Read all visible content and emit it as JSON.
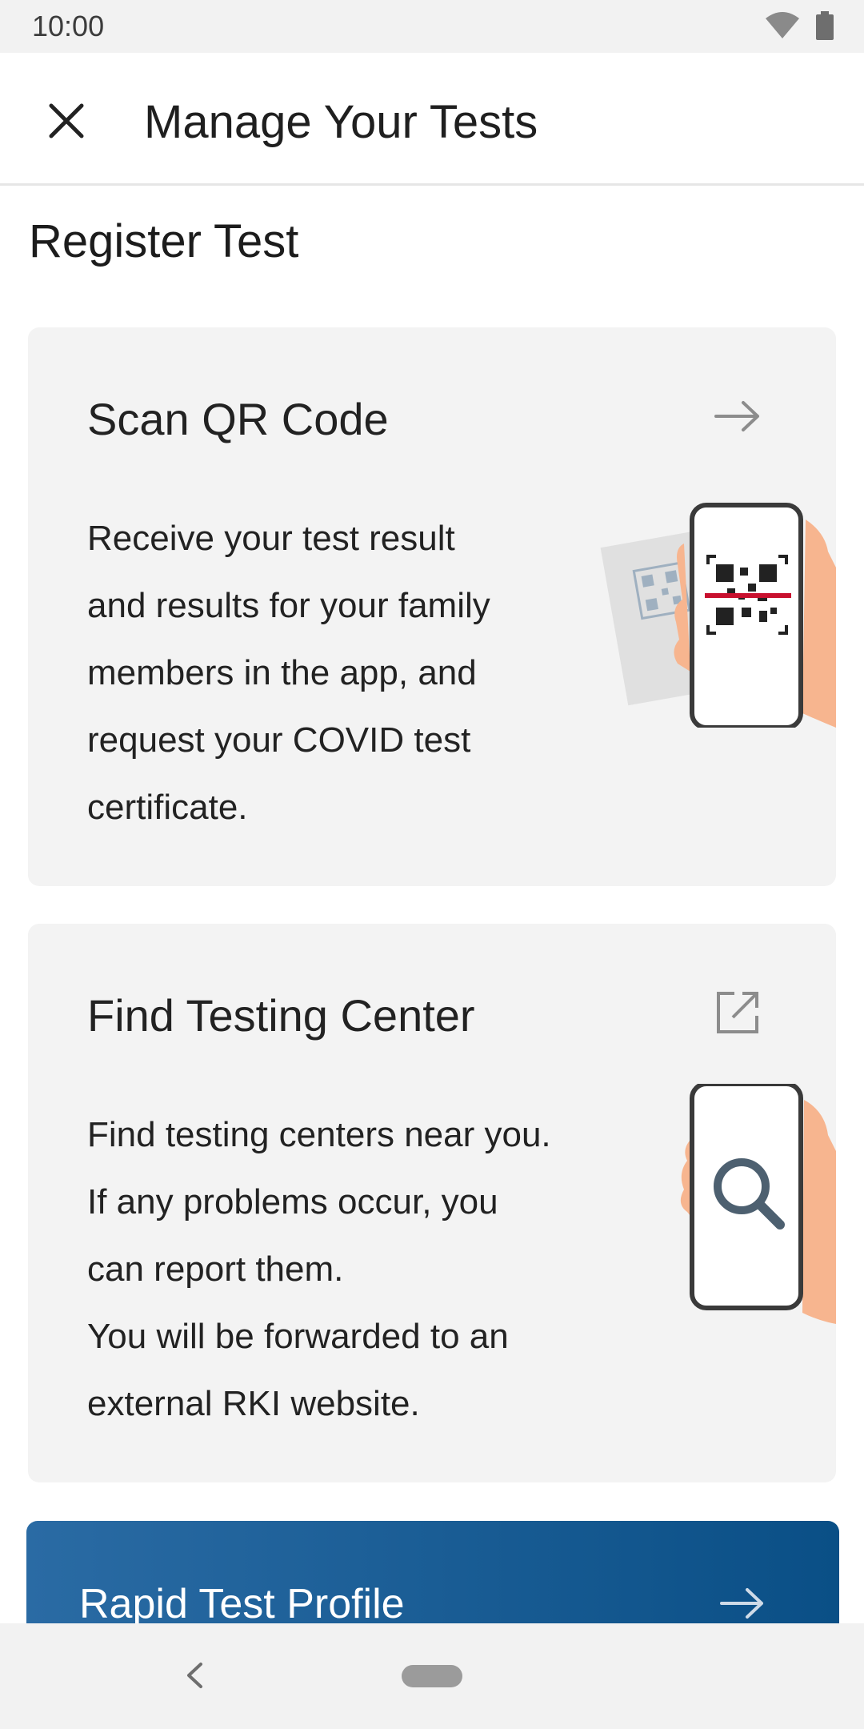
{
  "status_bar": {
    "time": "10:00",
    "icons": [
      "wifi-icon",
      "battery-icon"
    ]
  },
  "app_bar": {
    "title": "Manage Your Tests",
    "close_icon": "close-icon"
  },
  "section": {
    "title": "Register Test"
  },
  "cards": [
    {
      "title": "Scan QR Code",
      "action_icon": "arrow-right-icon",
      "lines": [
        "Receive your test result",
        "and results for your family",
        "members in the app, and",
        "request your COVID test",
        "certificate."
      ],
      "illustration": "phone-scanning-qr-code"
    },
    {
      "title": "Find Testing Center",
      "action_icon": "external-link-icon",
      "lines": [
        "Find testing centers near you.",
        "If any problems occur, you",
        "can report them.",
        "You will be forwarded to an",
        "external RKI website."
      ],
      "illustration": "phone-with-magnifier"
    }
  ],
  "rapid_test": {
    "label": "Rapid Test Profile",
    "icon": "arrow-right-icon"
  },
  "nav_bar": {
    "back_icon": "back-icon",
    "home_icon": "home-pill-icon"
  },
  "colors": {
    "accent": "#0a4f86",
    "accent_light": "#2a6ba4",
    "card_bg": "#f3f3f3",
    "scan_line": "#c8102e",
    "skin": "#f7b58f"
  }
}
